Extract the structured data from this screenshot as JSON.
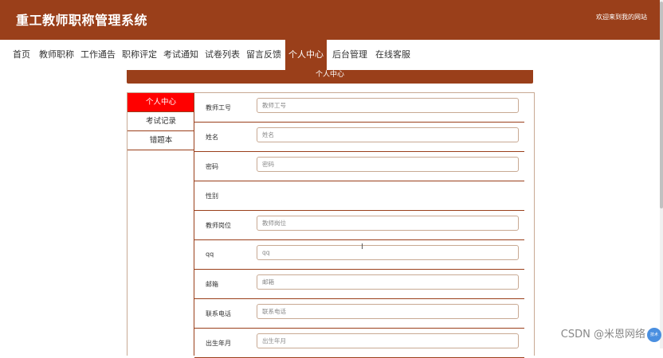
{
  "header": {
    "site_title": "重工教师职称管理系统",
    "welcome": "欢迎来到我的网站"
  },
  "nav": {
    "items": [
      {
        "label": "首页"
      },
      {
        "label": "教师职称"
      },
      {
        "label": "工作通告"
      },
      {
        "label": "职称评定"
      },
      {
        "label": "考试通知"
      },
      {
        "label": "试卷列表"
      },
      {
        "label": "留言反馈"
      },
      {
        "label": "个人中心",
        "active": true
      },
      {
        "label": "后台管理"
      },
      {
        "label": "在线客服"
      }
    ]
  },
  "banner": {
    "title": "个人中心"
  },
  "sidemenu": {
    "items": [
      {
        "label": "个人中心",
        "active": true
      },
      {
        "label": "考试记录"
      },
      {
        "label": "错题本"
      }
    ]
  },
  "form": {
    "fields": [
      {
        "label": "教师工号",
        "placeholder": "教师工号",
        "value": ""
      },
      {
        "label": "姓名",
        "placeholder": "姓名",
        "value": ""
      },
      {
        "label": "密码",
        "placeholder": "密码",
        "value": ""
      },
      {
        "label": "性别"
      },
      {
        "label": "教师岗位",
        "placeholder": "教师岗位",
        "value": ""
      },
      {
        "label": "qq",
        "placeholder": "qq",
        "value": ""
      },
      {
        "label": "邮箱",
        "placeholder": "邮箱",
        "value": ""
      },
      {
        "label": "联系电话",
        "placeholder": "联系电话",
        "value": ""
      },
      {
        "label": "出生年月",
        "placeholder": "出生年月",
        "value": ""
      }
    ]
  },
  "overlay": {
    "watermark": "CSDN @米恩网络",
    "float_button": "技术"
  },
  "colors": {
    "primary": "#9a3f1a",
    "side_active": "#ff0000",
    "input_border": "#c8a993"
  },
  "icons": {
    "text_cursor": "I-beam-icon"
  }
}
